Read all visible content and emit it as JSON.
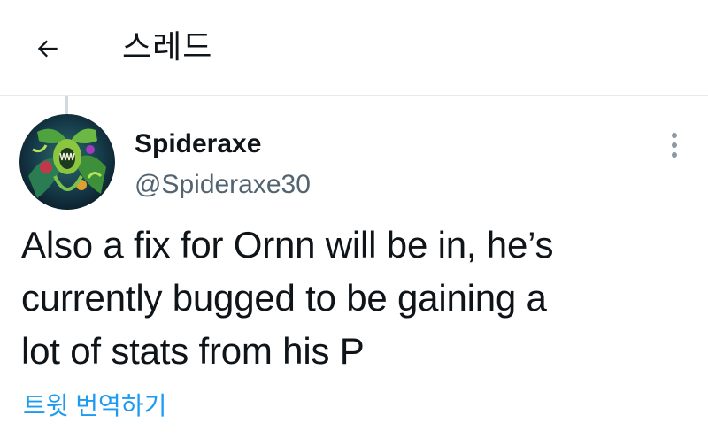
{
  "header": {
    "title": "스레드",
    "back_icon": "arrow-left-icon"
  },
  "tweet": {
    "author": {
      "display_name": "Spideraxe",
      "handle": "@Spideraxe30",
      "avatar": "avatar-image"
    },
    "text": "Also a fix for Ornn will be in, he’s\ncurrently bugged to be gaining a\nlot of stats from his P",
    "translate_label": "트윗 번역하기",
    "more_icon": "more-vertical-icon"
  },
  "colors": {
    "text": "#0f1419",
    "secondary": "#536471",
    "link": "#1d9bf0",
    "divider": "#e6e9ec"
  }
}
